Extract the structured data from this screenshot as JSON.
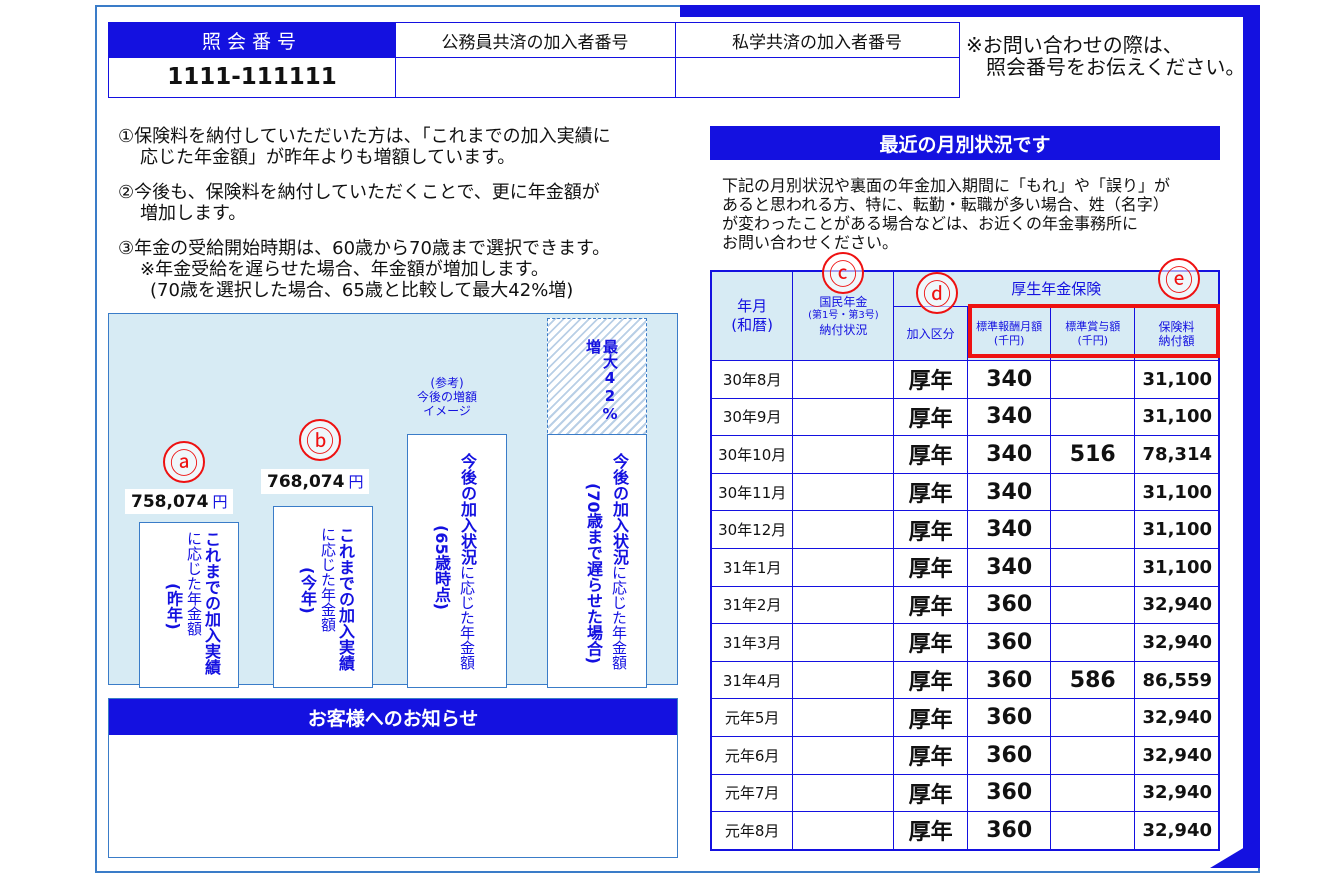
{
  "reference": {
    "header_label": "照会番号",
    "number": "1111-111111",
    "public_servant_label": "公務員共済の加入者番号",
    "private_school_label": "私学共済の加入者番号",
    "note_line1": "※お問い合わせの際は、",
    "note_line2": "照会番号をお伝えください。"
  },
  "info": {
    "item1_line1": "①保険料を納付していただいた方は、「これまでの加入実績に",
    "item1_line2": "応じた年金額」が昨年よりも増額しています。",
    "item2_line1": "②今後も、保険料を納付していただくことで、更に年金額が",
    "item2_line2": "増加します。",
    "item3_line1": "③年金の受給開始時期は、60歳から70歳まで選択できます。",
    "item3_line2": "※年金受給を遅らせた場合、年金額が増加します。",
    "item3_line3": "(70歳を選択した場合、65歳と比較して最大42%増)"
  },
  "chart": {
    "bar_a": {
      "circle": "ⓐ",
      "value": "758,074",
      "unit": "円",
      "bold": "これまでの加入実績",
      "normal": "に応じた年金額",
      "paren": "(昨年)"
    },
    "bar_b": {
      "circle": "ⓑ",
      "value": "768,074",
      "unit": "円",
      "bold": "これまでの加入実績",
      "normal": "に応じた年金額",
      "paren": "(今年)"
    },
    "bar_c": {
      "ref_line1": "(参考)",
      "ref_line2": "今後の増額",
      "ref_line3": "イメージ",
      "bold": "今後の加入状況",
      "normal": "に応じた年金額",
      "paren": "(65歳時点)"
    },
    "bar_d": {
      "max": "最大42%増",
      "bold": "今後の加入状況",
      "normal": "に応じた年金額",
      "paren": "(70歳まで遅らせた場合)"
    }
  },
  "monthly": {
    "title": "最近の月別状況です",
    "desc_line1": "下記の月別状況や裏面の年金加入期間に「もれ」や「誤り」が",
    "desc_line2": "あると思われる方、特に、転勤・転職が多い場合、姓（名字）",
    "desc_line3": "が変わったことがある場合などは、お近くの年金事務所に",
    "desc_line4": "お問い合わせください。",
    "circle_c": "ⓒ",
    "circle_d": "ⓓ",
    "circle_e": "ⓔ",
    "headers": {
      "month_line1": "年月",
      "month_line2": "(和暦)",
      "national_line1": "国民年金",
      "national_line2": "(第1号・第3号)",
      "national_line3": "納付状況",
      "kosei": "厚生年金保険",
      "kubun": "加入区分",
      "std_monthly_line1": "標準報酬月額",
      "std_monthly_line2": "(千円)",
      "std_bonus_line1": "標準賞与額",
      "std_bonus_line2": "(千円)",
      "premium_line1": "保険料",
      "premium_line2": "納付額"
    },
    "rows": [
      {
        "month": "30年8月",
        "kubun": "厚年",
        "std": "340",
        "bonus": "",
        "premium": "31,100"
      },
      {
        "month": "30年9月",
        "kubun": "厚年",
        "std": "340",
        "bonus": "",
        "premium": "31,100"
      },
      {
        "month": "30年10月",
        "kubun": "厚年",
        "std": "340",
        "bonus": "516",
        "premium": "78,314"
      },
      {
        "month": "30年11月",
        "kubun": "厚年",
        "std": "340",
        "bonus": "",
        "premium": "31,100"
      },
      {
        "month": "30年12月",
        "kubun": "厚年",
        "std": "340",
        "bonus": "",
        "premium": "31,100"
      },
      {
        "month": "31年1月",
        "kubun": "厚年",
        "std": "340",
        "bonus": "",
        "premium": "31,100"
      },
      {
        "month": "31年2月",
        "kubun": "厚年",
        "std": "360",
        "bonus": "",
        "premium": "32,940"
      },
      {
        "month": "31年3月",
        "kubun": "厚年",
        "std": "360",
        "bonus": "",
        "premium": "32,940"
      },
      {
        "month": "31年4月",
        "kubun": "厚年",
        "std": "360",
        "bonus": "586",
        "premium": "86,559"
      },
      {
        "month": "元年5月",
        "kubun": "厚年",
        "std": "360",
        "bonus": "",
        "premium": "32,940"
      },
      {
        "month": "元年6月",
        "kubun": "厚年",
        "std": "360",
        "bonus": "",
        "premium": "32,940"
      },
      {
        "month": "元年7月",
        "kubun": "厚年",
        "std": "360",
        "bonus": "",
        "premium": "32,940"
      },
      {
        "month": "元年8月",
        "kubun": "厚年",
        "std": "360",
        "bonus": "",
        "premium": "32,940"
      }
    ]
  },
  "notice": {
    "title": "お客様へのお知らせ"
  },
  "colors": {
    "brand_blue": "#1411e0",
    "light_blue": "#d7ebf4",
    "highlight_red": "#e11111"
  }
}
